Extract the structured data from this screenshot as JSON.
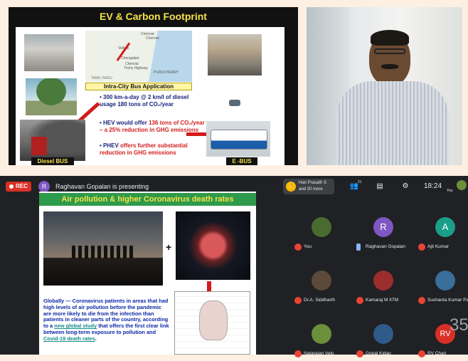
{
  "slide1": {
    "title": "EV & Carbon Footprint",
    "map_labels": [
      "Chennai",
      "Chennai",
      "Vellore",
      "Chengalpet",
      "Chennai",
      "Trichy Highway",
      "PUDUCHERRY",
      "TAMIL NADU"
    ],
    "callout": "Intra-City Bus Application",
    "bullet1": "300 km-a-day @ 2 km/l of diesel usage 180 tons of CO₂/year",
    "bullet2_lead": "HEV would offer ",
    "bullet2_red": "136 tons of CO₂/year – a 25% reduction in GHG emissions",
    "bullet3_lead": "PHEV ",
    "bullet3_red": "offers further substantial reduction in GHG emissions",
    "label_diesel": "Diesel  BUS",
    "label_ebus": "E -BUS"
  },
  "meeting": {
    "rec_label": "REC",
    "presenter_initial": "R",
    "presenting_text": "Raghavan Gopalan is presenting",
    "hand_name": "Hari Prasath S",
    "hand_more": "and 20 more",
    "people_count": "21",
    "time": "18:24",
    "you_label": "You",
    "big_number": "35"
  },
  "slide2": {
    "title": "Air pollution & higher Coronavirus death rates",
    "plus": "+",
    "text_lead": "Globally — Coronavirus patients in areas that had high levels of air pollution before the pandemic are more likely to die from the infection than patients in cleaner parts of the country, according to a ",
    "link1": "new global study",
    "text_mid": " that offers the first clear link between long-term exposure to pollution and ",
    "link2": "Covid-19 death rates",
    "text_end": "."
  },
  "participants": [
    {
      "name": "You",
      "kind": "photo",
      "color": "#4a6b2f"
    },
    {
      "name": "Raghavan Gopalan",
      "kind": "letter",
      "letter": "R",
      "color": "#7e57c2",
      "speaking": true
    },
    {
      "name": "Ajit Kumar",
      "kind": "letter",
      "letter": "A",
      "color": "#1a9f8b"
    },
    {
      "name": "Dr.A. Siddharth",
      "kind": "photo",
      "color": "#5b4a3a"
    },
    {
      "name": "Kamaraj M IITM",
      "kind": "photo",
      "color": "#9b2d2d"
    },
    {
      "name": "Sushanta Kumar Pan",
      "kind": "photo",
      "color": "#3a6e9b"
    },
    {
      "name": "Natarajan Velu",
      "kind": "photo",
      "color": "#6b8f3a"
    },
    {
      "name": "Gopal Kidao",
      "kind": "photo",
      "color": "#2f5a8a"
    },
    {
      "name": "RV Chari",
      "kind": "letter",
      "letter": "RV",
      "color": "#d93025"
    }
  ],
  "colors": {
    "meet_bg": "#202124",
    "rec": "#d93025",
    "slide2_title_bg": "#2e9a4b",
    "slide_title_yellow": "#f6e24a"
  }
}
